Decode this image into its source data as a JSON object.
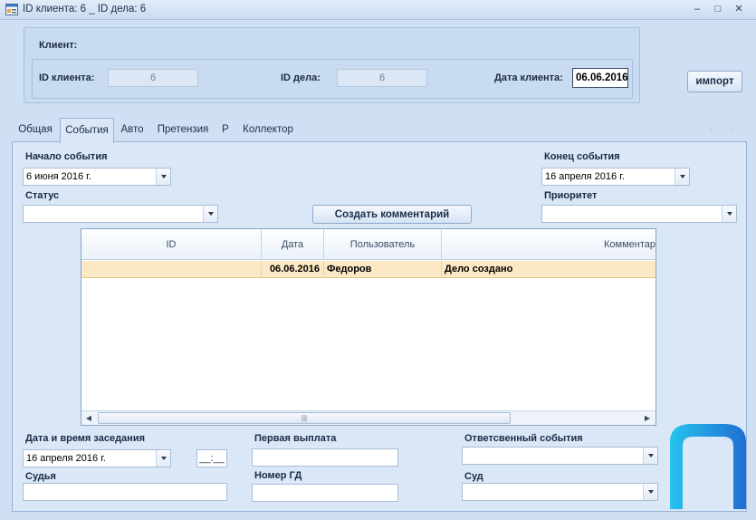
{
  "window": {
    "title": "ID клиента: 6 _ ID дела: 6",
    "min_glyph": "–",
    "max_glyph": "□",
    "close_glyph": "✕"
  },
  "client": {
    "group_title": "Клиент:",
    "client_id_label": "ID клиента:",
    "client_id_value": "6",
    "case_id_label": "ID дела:",
    "case_id_value": "6",
    "client_date_label": "Дата клиента:",
    "client_date_value": "06.06.2016"
  },
  "import_button": "импорт",
  "tabs": [
    {
      "label": "Общая",
      "active": false
    },
    {
      "label": "События",
      "active": true
    },
    {
      "label": "Авто",
      "active": false
    },
    {
      "label": "Претензия",
      "active": false
    },
    {
      "label": "Р",
      "active": false
    },
    {
      "label": "Коллектор",
      "active": false
    }
  ],
  "tab_scroll_glyphs": "‹ ›",
  "events": {
    "start_label": "Начало события",
    "start_value": "6 июня 2016 г.",
    "end_label": "Конец события",
    "end_value": "16 апреля 2016 г.",
    "status_label": "Статус",
    "status_value": "",
    "priority_label": "Приоритет",
    "priority_value": "",
    "create_comment_button": "Создать комментарий"
  },
  "grid": {
    "columns": [
      "ID",
      "Дата",
      "Пользователь",
      "Комментар"
    ],
    "rows": [
      {
        "id": "",
        "date": "06.06.2016",
        "user": "Федоров",
        "comment": "Дело создано"
      }
    ],
    "scroll_left_glyph": "◀",
    "scroll_right_glyph": "▶",
    "scroll_grip_glyph": "|||"
  },
  "bottom": {
    "session_label": "Дата и время заседания",
    "session_date_value": "16 апреля 2016 г.",
    "session_time_value": "__:__",
    "judge_label": "Судья",
    "first_payment_label": "Первая выплата",
    "gd_number_label": "Номер ГД",
    "responsible_label": "Ответсвенный события",
    "court_label": "Суд"
  },
  "colors": {
    "window_bg": "#cfe0f4",
    "selected_row": "#fce8c4",
    "logo_cyan": "#1ab4e8",
    "logo_blue": "#1f6fd1"
  },
  "icons": {
    "app": "form-icon",
    "logo": "brand-logo"
  }
}
